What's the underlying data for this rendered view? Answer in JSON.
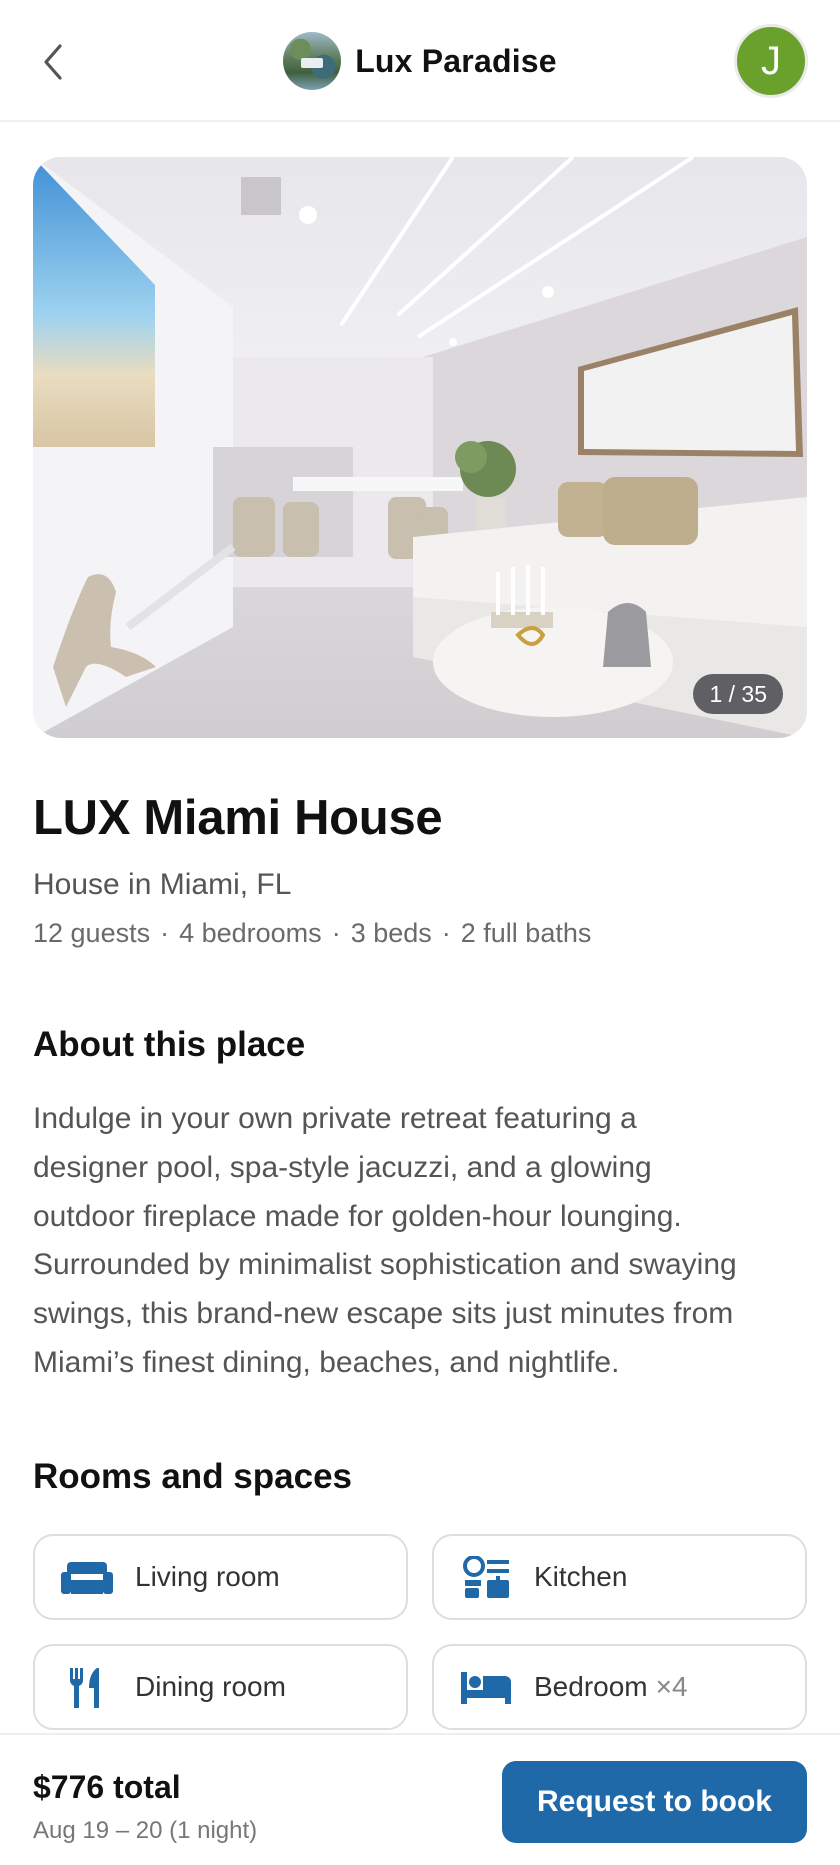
{
  "header": {
    "brand_name": "Lux Paradise",
    "avatar_initial": "J",
    "avatar_color": "#6aa02c"
  },
  "gallery": {
    "counter": "1 / 35"
  },
  "listing": {
    "title": "LUX Miami House",
    "subtitle": "House in Miami, FL",
    "meta": {
      "guests": "12 guests",
      "bedrooms": "4 bedrooms",
      "beds": "3 beds",
      "baths": "2 full baths",
      "separator": "·"
    }
  },
  "about": {
    "heading": "About this place",
    "lines": [
      "Indulge in your own private retreat featuring a",
      "designer pool, spa-style jacuzzi, and a glowing",
      "outdoor fireplace made for golden-hour lounging.",
      "Surrounded by minimalist sophistication and swaying",
      "swings, this brand-new escape sits just minutes from",
      "Miami’s finest dining, beaches, and nightlife."
    ]
  },
  "rooms": {
    "heading": "Rooms and spaces",
    "items": [
      {
        "label": "Living room",
        "icon": "sofa-icon"
      },
      {
        "label": "Kitchen",
        "icon": "kitchen-icon"
      },
      {
        "label": "Dining room",
        "icon": "fork-knife-icon"
      },
      {
        "label": "Bedroom",
        "count": "×4",
        "icon": "bed-icon"
      }
    ]
  },
  "footer": {
    "total": "$776 total",
    "dates": "Aug 19 – 20 (1 night)",
    "cta": "Request to book"
  },
  "colors": {
    "accent": "#1f69a8",
    "icon": "#1f69a8"
  }
}
